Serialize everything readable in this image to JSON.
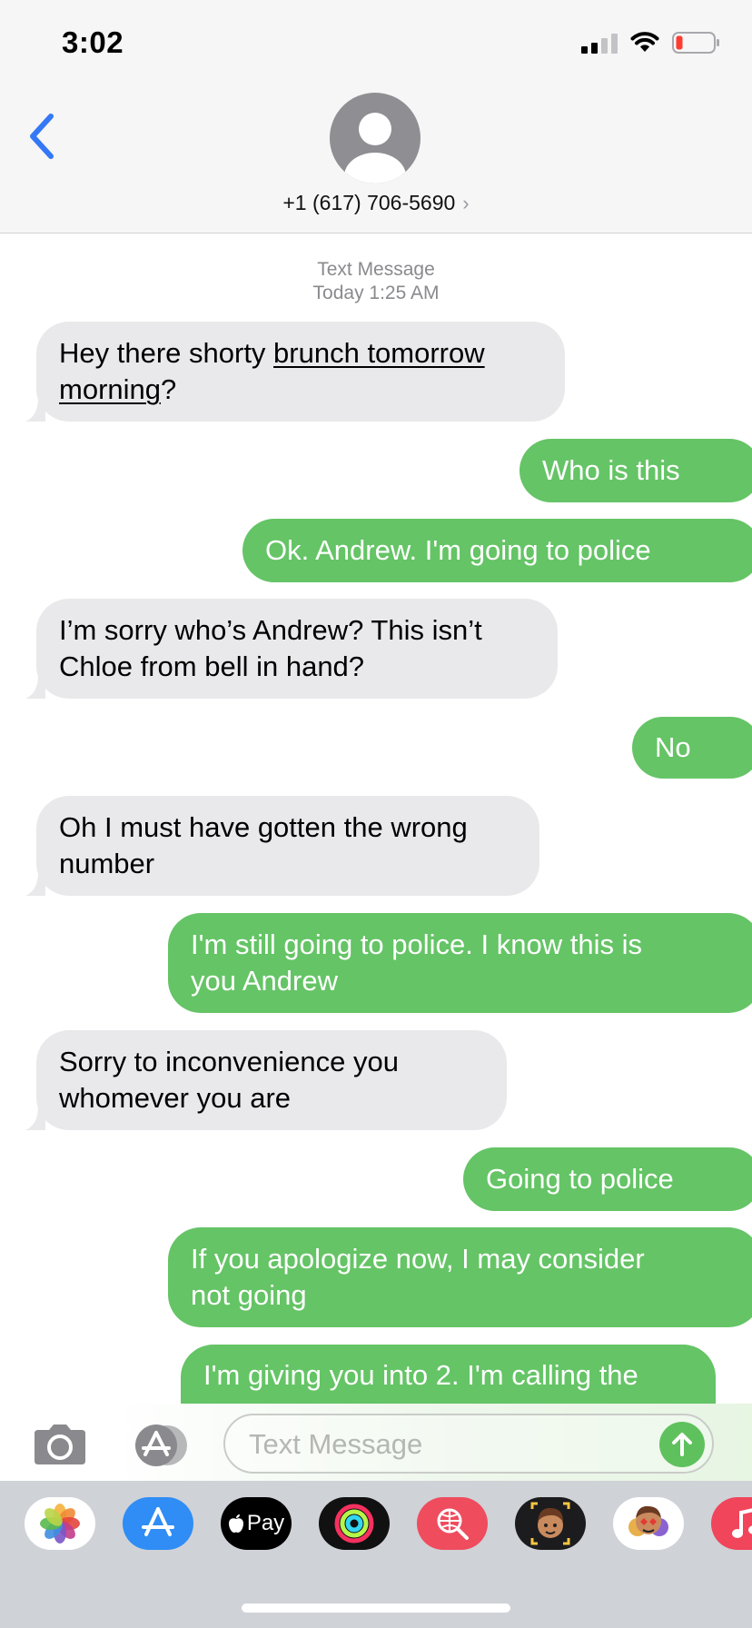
{
  "status": {
    "time": "3:02"
  },
  "header": {
    "contact": "+1 (617) 706-5690",
    "chevron": "›"
  },
  "thread": {
    "service_label": "Text Message",
    "timestamp": "Today 1:25 AM",
    "messages": [
      {
        "dir": "in",
        "text_a": "Hey there shorty ",
        "link": "brunch tomorrow",
        "link2": "morning",
        "text_b": "?"
      },
      {
        "dir": "out",
        "text": "Who is this"
      },
      {
        "dir": "out",
        "text": "Ok. Andrew. I'm going to police"
      },
      {
        "dir": "in",
        "line1": "I’m sorry who’s Andrew? This isn’t",
        "line2": "Chloe from bell in hand?"
      },
      {
        "dir": "out",
        "text": "No"
      },
      {
        "dir": "in",
        "line1": "Oh I must have gotten the wrong",
        "line2": "number"
      },
      {
        "dir": "out",
        "line1": "I'm still going to police. I know this is",
        "line2": "you Andrew"
      },
      {
        "dir": "in",
        "line1": "Sorry to inconvenience you",
        "line2": "whomever you are"
      },
      {
        "dir": "out",
        "text": "Going to police"
      },
      {
        "dir": "out",
        "line1": "If you apologize now, I may consider",
        "line2": "not going"
      },
      {
        "dir": "out",
        "line1": "I'm giving you into 2. I'm calling the"
      }
    ]
  },
  "composer": {
    "placeholder": "Text Message"
  },
  "apps": [
    {
      "name": "Photos"
    },
    {
      "name": "App Store"
    },
    {
      "name": "Apple Pay",
      "label": "Pay"
    },
    {
      "name": "Activity"
    },
    {
      "name": "Images Search"
    },
    {
      "name": "Memoji"
    },
    {
      "name": "Memoji Stickers"
    },
    {
      "name": "Music"
    }
  ],
  "colors": {
    "outgoing": "#65c466",
    "incoming": "#e9e9eb",
    "accent": "#3478f6"
  }
}
